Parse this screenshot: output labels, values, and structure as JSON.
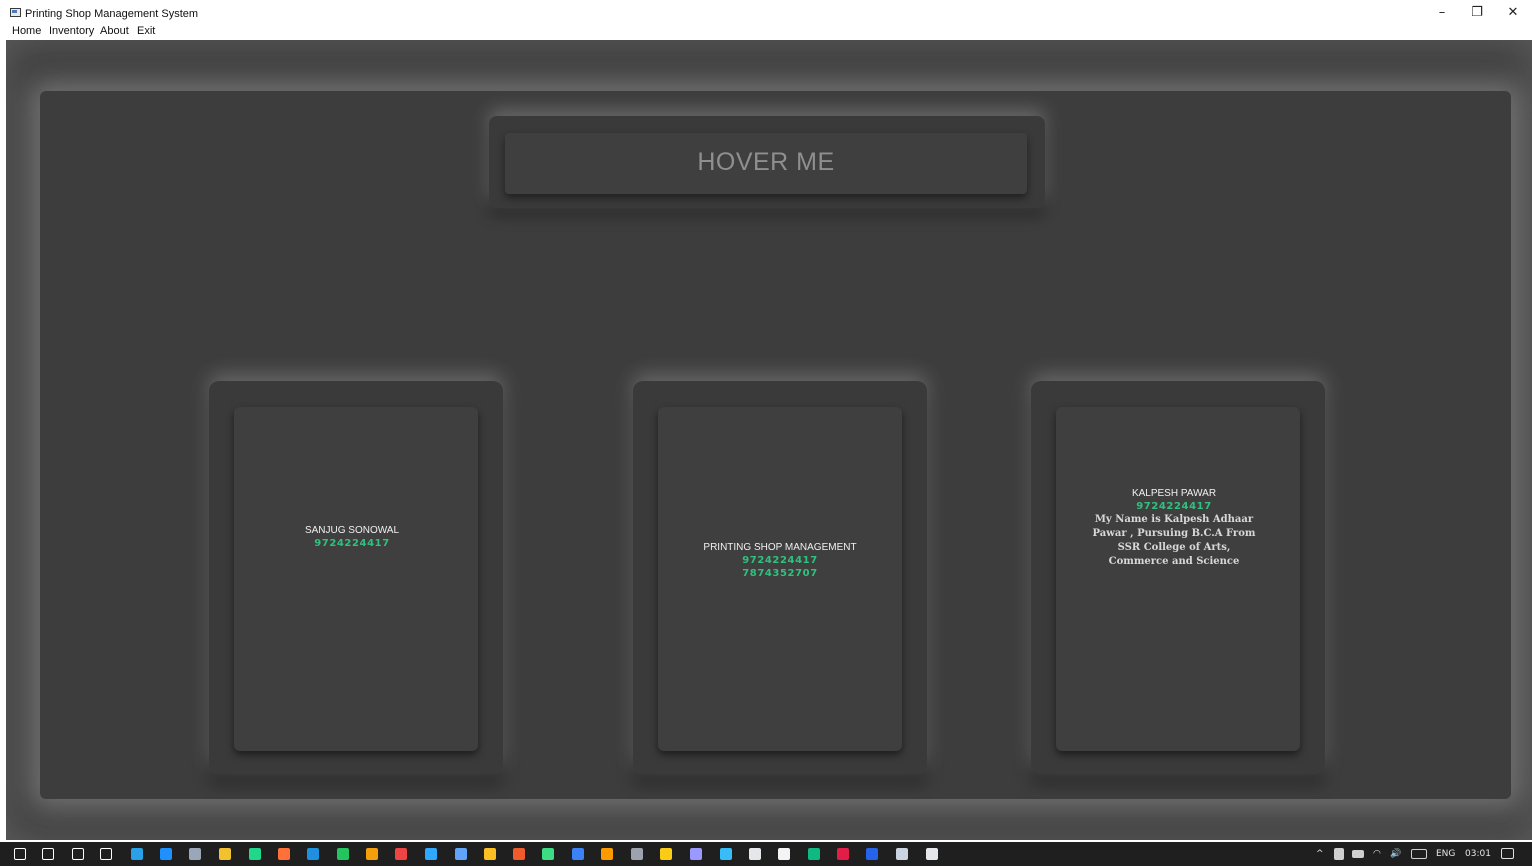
{
  "window": {
    "title": "Printing Shop Management System",
    "minimize": "–",
    "restore": "❐",
    "close": "✕"
  },
  "menu": [
    "Home",
    "Inventory",
    "About",
    "Exit"
  ],
  "hover_button": {
    "label": "HOVER ME"
  },
  "cards": [
    {
      "name": "SANJUG SONOWAL",
      "phones": [
        "9724224417"
      ],
      "bio": ""
    },
    {
      "name": "PRINTING SHOP MANAGEMENT",
      "phones": [
        "9724224417",
        "7874352707"
      ],
      "bio": ""
    },
    {
      "name": "KALPESH PAWAR",
      "phones": [
        "9724224417"
      ],
      "bio": "My Name is Kalpesh Adhaar Pawar , Pursuing B.C.A From SSR College of Arts, Commerce and Science"
    }
  ],
  "taskbar": {
    "tray_lang": "ENG",
    "clock": "03:01",
    "icons": [
      {
        "name": "windows-start-icon",
        "color": "#ffffff"
      },
      {
        "name": "search-icon",
        "color": "#ffffff"
      },
      {
        "name": "cortana-icon",
        "color": "#ffffff"
      },
      {
        "name": "task-view-icon",
        "color": "#ffffff"
      },
      {
        "name": "edge-icon",
        "color": "#2aa0e6"
      },
      {
        "name": "mail-icon",
        "color": "#1e90ff"
      },
      {
        "name": "snipping-tool-icon",
        "color": "#9aa7b8"
      },
      {
        "name": "file-explorer-icon",
        "color": "#f2c12e"
      },
      {
        "name": "pycharm-icon",
        "color": "#21d789"
      },
      {
        "name": "firefox-icon",
        "color": "#ff7139"
      },
      {
        "name": "vscode-icon",
        "color": "#1f8fe0"
      },
      {
        "name": "clion-icon",
        "color": "#22c55e"
      },
      {
        "name": "app-icon-orange",
        "color": "#f59e0b"
      },
      {
        "name": "app-icon-red",
        "color": "#ef4444"
      },
      {
        "name": "photoshop-icon",
        "color": "#31a8ff"
      },
      {
        "name": "app-icon-blue",
        "color": "#60a5fa"
      },
      {
        "name": "chrome-icon",
        "color": "#fbbf24"
      },
      {
        "name": "powerpoint-icon",
        "color": "#ef5b2a"
      },
      {
        "name": "android-studio-icon",
        "color": "#3ddc84"
      },
      {
        "name": "app-icon-blue2",
        "color": "#3b82f6"
      },
      {
        "name": "illustrator-icon",
        "color": "#ff9a00"
      },
      {
        "name": "app-icon-grey",
        "color": "#9ca3af"
      },
      {
        "name": "app-icon-multi",
        "color": "#facc15"
      },
      {
        "name": "after-effects-icon",
        "color": "#9999ff"
      },
      {
        "name": "app-icon-cyan",
        "color": "#38bdf8"
      },
      {
        "name": "notepad-icon",
        "color": "#e5e7eb"
      },
      {
        "name": "app-icon-white",
        "color": "#f3f4f6"
      },
      {
        "name": "app-icon-gradient",
        "color": "#10b981"
      },
      {
        "name": "acrobat-icon",
        "color": "#e11d48"
      },
      {
        "name": "app-icon-blue3",
        "color": "#2563eb"
      },
      {
        "name": "notes-icon",
        "color": "#cbd5e1"
      },
      {
        "name": "settings-icon",
        "color": "#e5e7eb"
      }
    ]
  }
}
